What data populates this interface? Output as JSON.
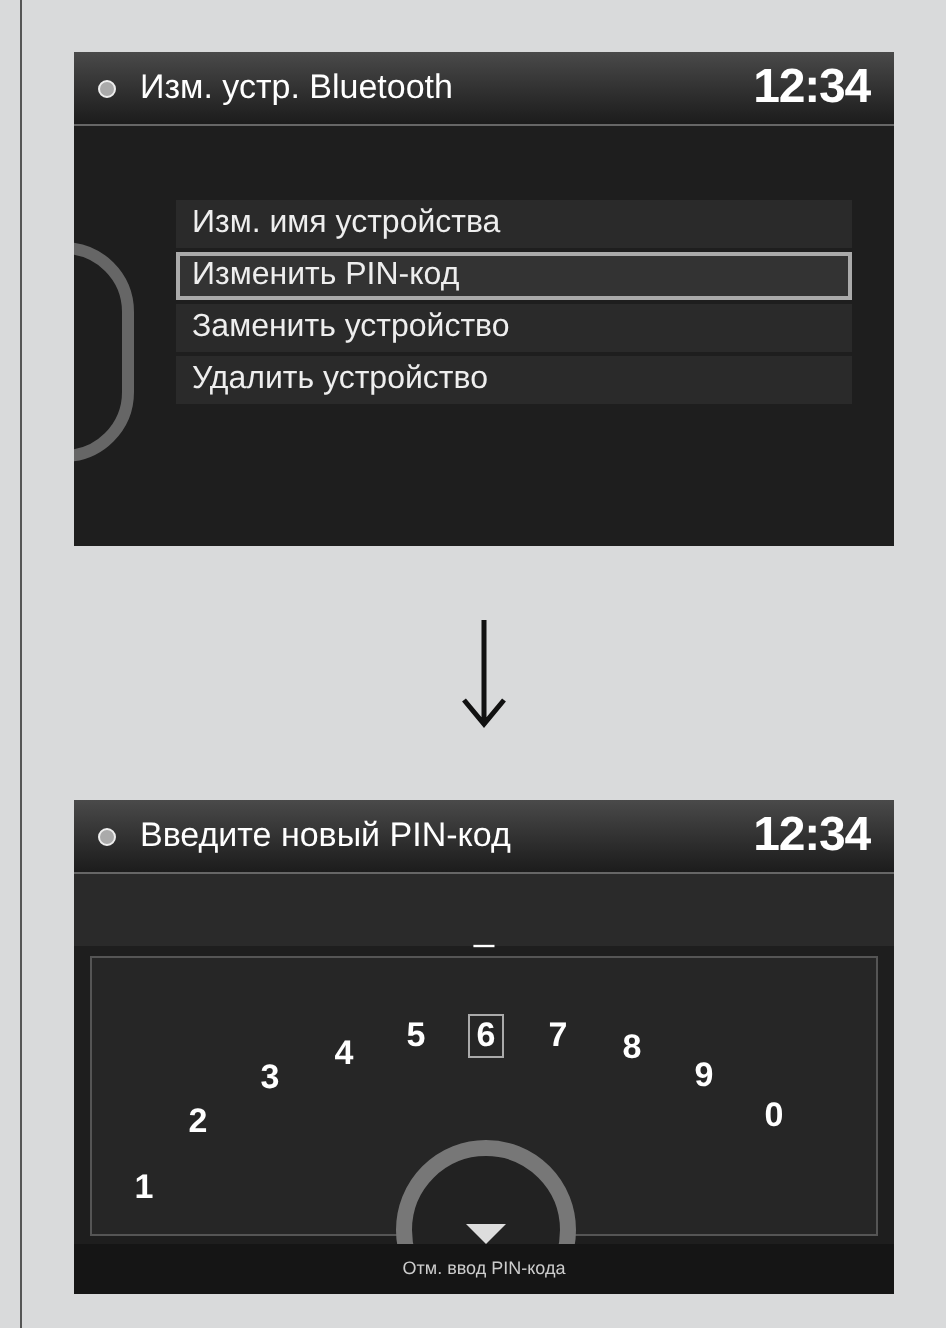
{
  "screens": [
    {
      "kind": "menu",
      "title": "Изм. устр. Bluetooth",
      "clock": "12:34",
      "items": [
        {
          "label": "Изм. имя устройства",
          "selected": false
        },
        {
          "label": "Изменить PIN-код",
          "selected": true
        },
        {
          "label": "Заменить устройство",
          "selected": false
        },
        {
          "label": "Удалить устройство",
          "selected": false
        }
      ]
    },
    {
      "kind": "keypad",
      "title": "Введите новый PIN-код",
      "clock": "12:34",
      "entry": "_",
      "keys": [
        {
          "label": "1",
          "selected": false
        },
        {
          "label": "2",
          "selected": false
        },
        {
          "label": "3",
          "selected": false
        },
        {
          "label": "4",
          "selected": false
        },
        {
          "label": "5",
          "selected": false
        },
        {
          "label": "6",
          "selected": true
        },
        {
          "label": "7",
          "selected": false
        },
        {
          "label": "8",
          "selected": false
        },
        {
          "label": "9",
          "selected": false
        },
        {
          "label": "0",
          "selected": false
        }
      ],
      "hint": "Отм. ввод PIN-кода"
    }
  ]
}
